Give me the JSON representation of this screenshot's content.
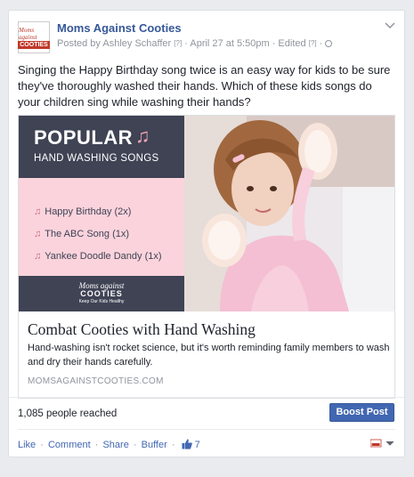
{
  "post": {
    "page_name": "Moms Against Cooties",
    "author_prefix": "Posted by",
    "author": "Ashley Schaffer",
    "author_marker": "[?]",
    "sep1": " · ",
    "date": "April 27 at 5:50pm",
    "sep2": " · ",
    "edited": "Edited",
    "edited_marker": "[?]",
    "sep3": " · ",
    "text": "Singing the Happy Birthday song twice is an easy way for kids to be sure they've thoroughly washed their hands. Which of these kids songs do your children sing while washing their hands?"
  },
  "avatar": {
    "line1": "Moms against",
    "line2": "COOTIES"
  },
  "link": {
    "image": {
      "heading": "POPULAR",
      "note_glyph": "♫",
      "subheading": "HAND WASHING SONGS",
      "song_glyph": "♫",
      "songs": [
        "Happy Birthday (2x)",
        "The ABC Song (1x)",
        "Yankee Doodle Dandy (1x)"
      ],
      "logo_line1": "Moms against",
      "logo_line2": "COOTIES",
      "logo_line3": "Keep Our Kids Healthy"
    },
    "title": "Combat Cooties with Hand Washing",
    "description": "Hand-washing isn't rocket science, but it's worth reminding family members to wash and dry their hands carefully.",
    "domain": "MOMSAGAINSTCOOTIES.COM"
  },
  "stats": {
    "reached": "1,085 people reached",
    "boost_label": "Boost Post"
  },
  "actions": {
    "like": "Like",
    "comment": "Comment",
    "share": "Share",
    "buffer": "Buffer",
    "sep": "·",
    "like_count": "7"
  },
  "colors": {
    "link_blue": "#365899",
    "boost_blue": "#4267b2",
    "dark_slate": "#3f4354",
    "pink": "#fbd3dc"
  }
}
